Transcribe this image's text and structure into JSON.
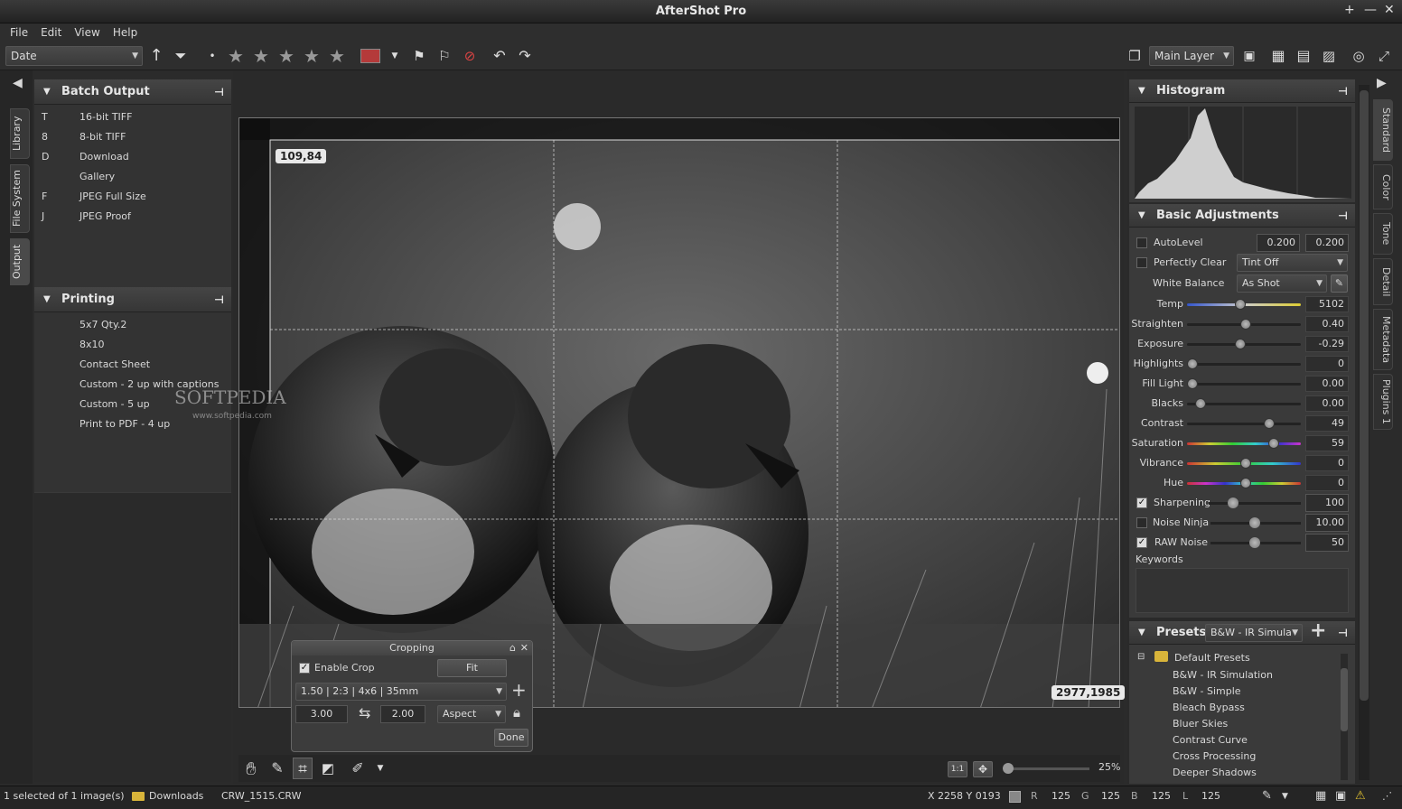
{
  "window": {
    "title": "AfterShot Pro"
  },
  "menu": [
    "File",
    "Edit",
    "View",
    "Help"
  ],
  "toolbar": {
    "sort": "Date",
    "layer": "Main Layer",
    "label_color": "#b43a3a"
  },
  "left_tabs": [
    "Library",
    "File System",
    "Output"
  ],
  "batch_output": {
    "title": "Batch Output",
    "items": [
      {
        "key": "T",
        "label": "16-bit TIFF"
      },
      {
        "key": "8",
        "label": "8-bit TIFF"
      },
      {
        "key": "D",
        "label": "Download"
      },
      {
        "key": "",
        "label": "Gallery"
      },
      {
        "key": "F",
        "label": "JPEG Full Size"
      },
      {
        "key": "J",
        "label": "JPEG Proof"
      }
    ]
  },
  "printing": {
    "title": "Printing",
    "items": [
      "5x7 Qty.2",
      "8x10",
      "Contact Sheet",
      "Custom - 2 up with captions",
      "Custom - 5 up",
      "Print to PDF - 4 up"
    ]
  },
  "watermark": {
    "brand": "SOFTPEDIA",
    "url": "www.softpedia.com"
  },
  "viewer": {
    "coord_tl": "109,84",
    "coord_br": "2977,1985"
  },
  "cropping": {
    "title": "Cropping",
    "enable_label": "Enable Crop",
    "fit": "Fit",
    "preset": "1.50 | 2:3 | 4x6 | 35mm",
    "width": "3.00",
    "height": "2.00",
    "mode": "Aspect",
    "done": "Done"
  },
  "bottom_tools": {
    "zoom": "25%"
  },
  "right_tabs": [
    "Standard",
    "Color",
    "Tone",
    "Detail",
    "Metadata",
    "Plugins 1"
  ],
  "histogram": {
    "title": "Histogram"
  },
  "basic": {
    "title": "Basic Adjustments",
    "autolevel": {
      "label": "AutoLevel",
      "v1": "0.200",
      "v2": "0.200"
    },
    "perfectly_clear": {
      "label": "Perfectly Clear",
      "value": "Tint Off"
    },
    "white_balance": {
      "label": "White Balance",
      "value": "As Shot"
    },
    "sliders": [
      {
        "label": "Temp",
        "value": "5102",
        "pos": 0.45
      },
      {
        "label": "Straighten",
        "value": "0.40",
        "pos": 0.5
      },
      {
        "label": "Exposure",
        "value": "-0.29",
        "pos": 0.45
      },
      {
        "label": "Highlights",
        "value": "0",
        "pos": 0.0
      },
      {
        "label": "Fill Light",
        "value": "0.00",
        "pos": 0.0
      },
      {
        "label": "Blacks",
        "value": "0.00",
        "pos": 0.08
      },
      {
        "label": "Contrast",
        "value": "49",
        "pos": 0.72
      },
      {
        "label": "Saturation",
        "value": "59",
        "pos": 0.76
      },
      {
        "label": "Vibrance",
        "value": "0",
        "pos": 0.5
      },
      {
        "label": "Hue",
        "value": "0",
        "pos": 0.5
      }
    ],
    "sharpening": {
      "label": "Sharpening",
      "value": "100",
      "checked": true
    },
    "noise_ninja": {
      "label": "Noise Ninja",
      "value": "10.00",
      "checked": false
    },
    "raw_noise": {
      "label": "RAW Noise",
      "value": "50",
      "checked": true
    },
    "keywords": "Keywords"
  },
  "presets": {
    "title": "Presets",
    "current": "B&W - IR Simula",
    "folder": "Default Presets",
    "items": [
      "B&W - IR Simulation",
      "B&W - Simple",
      "Bleach Bypass",
      "Bluer Skies",
      "Contrast Curve",
      "Cross Processing",
      "Deeper Shadows"
    ]
  },
  "status": {
    "selection": "1 selected of 1 image(s)",
    "folder": "Downloads",
    "file": "CRW_1515.CRW",
    "xy": "X 2258  Y 0193",
    "r_label": "R",
    "r": "125",
    "g_label": "G",
    "g": "125",
    "b_label": "B",
    "b": "125",
    "l_label": "L",
    "l": "125"
  }
}
